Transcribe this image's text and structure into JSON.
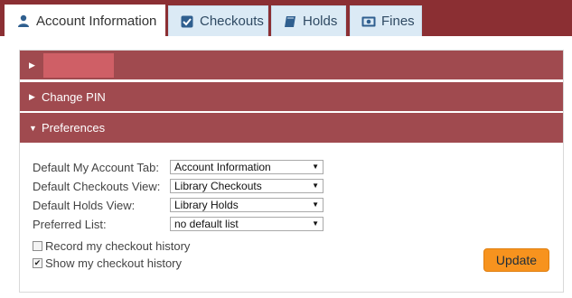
{
  "tabs": [
    {
      "label": "Account Information",
      "icon": "user-icon",
      "active": true
    },
    {
      "label": "Checkouts",
      "icon": "checkbox-icon",
      "active": false
    },
    {
      "label": "Holds",
      "icon": "book-icon",
      "active": false
    },
    {
      "label": "Fines",
      "icon": "money-icon",
      "active": false
    }
  ],
  "accordion": {
    "section1": {
      "label": "",
      "expanded": false
    },
    "section2": {
      "label": "Change PIN",
      "expanded": false
    },
    "section3": {
      "label": "Preferences",
      "expanded": true
    }
  },
  "preferences": {
    "default_tab": {
      "label": "Default My Account Tab:",
      "value": "Account Information"
    },
    "checkouts_view": {
      "label": "Default Checkouts View:",
      "value": "Library Checkouts"
    },
    "holds_view": {
      "label": "Default Holds View:",
      "value": "Library Holds"
    },
    "preferred_list": {
      "label": "Preferred List:",
      "value": "no default list"
    },
    "record_history": {
      "label": "Record my checkout history",
      "checked": false
    },
    "show_history": {
      "label": "Show my checkout history",
      "checked": true
    },
    "update_label": "Update"
  },
  "colors": {
    "tabbar": "#8b2f33",
    "accordion_header": "#a04a4f",
    "tab_inactive": "#dbeaf5",
    "update_button": "#f7931e"
  }
}
